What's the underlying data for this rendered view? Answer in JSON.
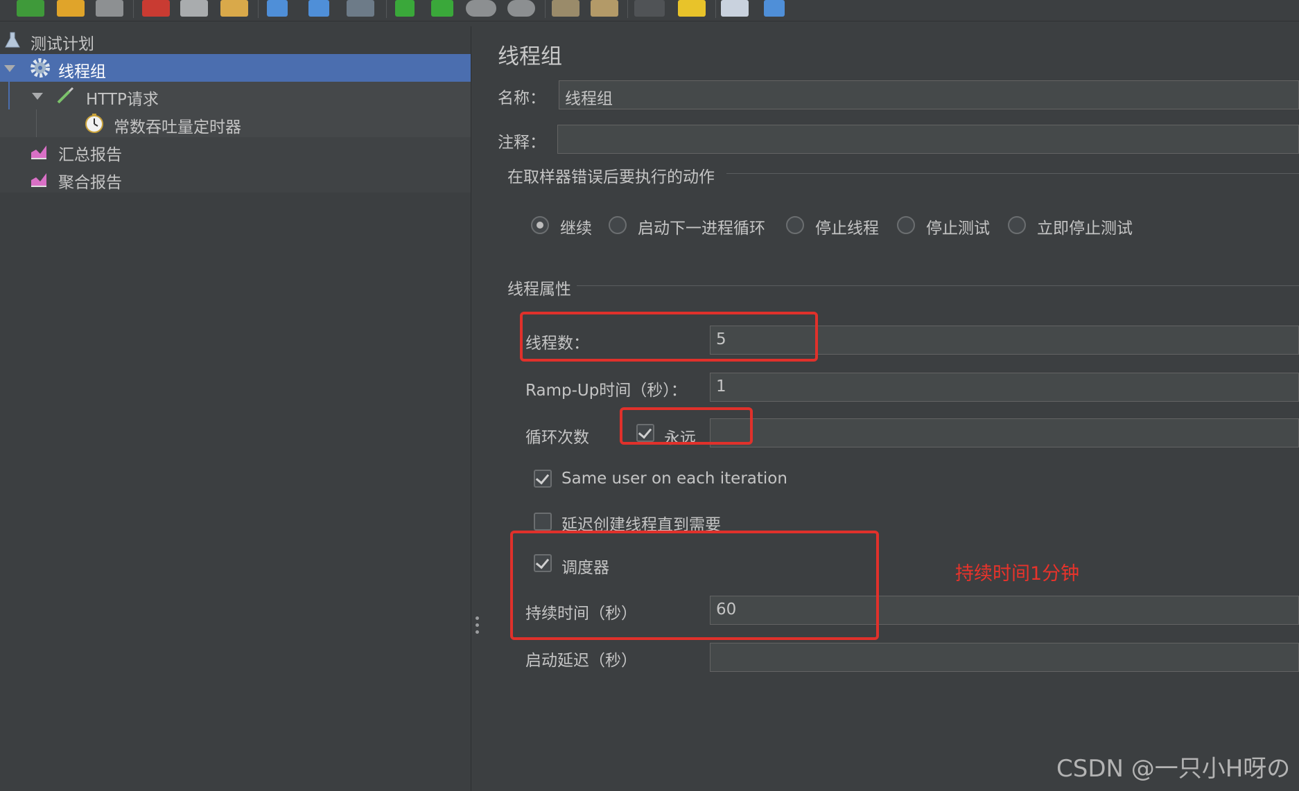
{
  "tree": {
    "items": [
      {
        "label": "测试计划",
        "icon": "flask-icon"
      },
      {
        "label": "线程组",
        "icon": "gear-icon"
      },
      {
        "label": "HTTP请求",
        "icon": "pipette-icon"
      },
      {
        "label": "常数吞吐量定时器",
        "icon": "stopwatch-icon"
      },
      {
        "label": "汇总报告",
        "icon": "chart-report-icon"
      },
      {
        "label": "聚合报告",
        "icon": "chart-report-icon"
      }
    ]
  },
  "panel": {
    "title": "线程组",
    "name_label": "名称：",
    "name_value": "线程组",
    "comment_label": "注释：",
    "comment_value": "",
    "error_section": "在取样器错误后要执行的动作",
    "error_actions": [
      "继续",
      "启动下一进程循环",
      "停止线程",
      "停止测试",
      "立即停止测试"
    ],
    "error_selected": "继续",
    "thread_section": "线程属性",
    "threads_label": "线程数：",
    "threads_value": "5",
    "rampup_label": "Ramp-Up时间（秒）：",
    "rampup_value": "1",
    "loop_label": "循环次数",
    "loop_forever_label": "永远",
    "loop_forever_checked": true,
    "loop_value": "",
    "same_user_label": "Same user on each iteration",
    "same_user_checked": true,
    "delay_create_label": "延迟创建线程直到需要",
    "delay_create_checked": false,
    "scheduler_label": "调度器",
    "scheduler_checked": true,
    "duration_label": "持续时间（秒）",
    "duration_value": "60",
    "startup_delay_label": "启动延迟（秒）",
    "startup_delay_value": ""
  },
  "annotation": {
    "text": "持续时间1分钟",
    "color": "#e8332b"
  },
  "watermark": "CSDN @一只小H呀の",
  "colors": {
    "background": "#3c3f41",
    "selection": "#4b6eaf",
    "highlight": "#e0312b"
  }
}
